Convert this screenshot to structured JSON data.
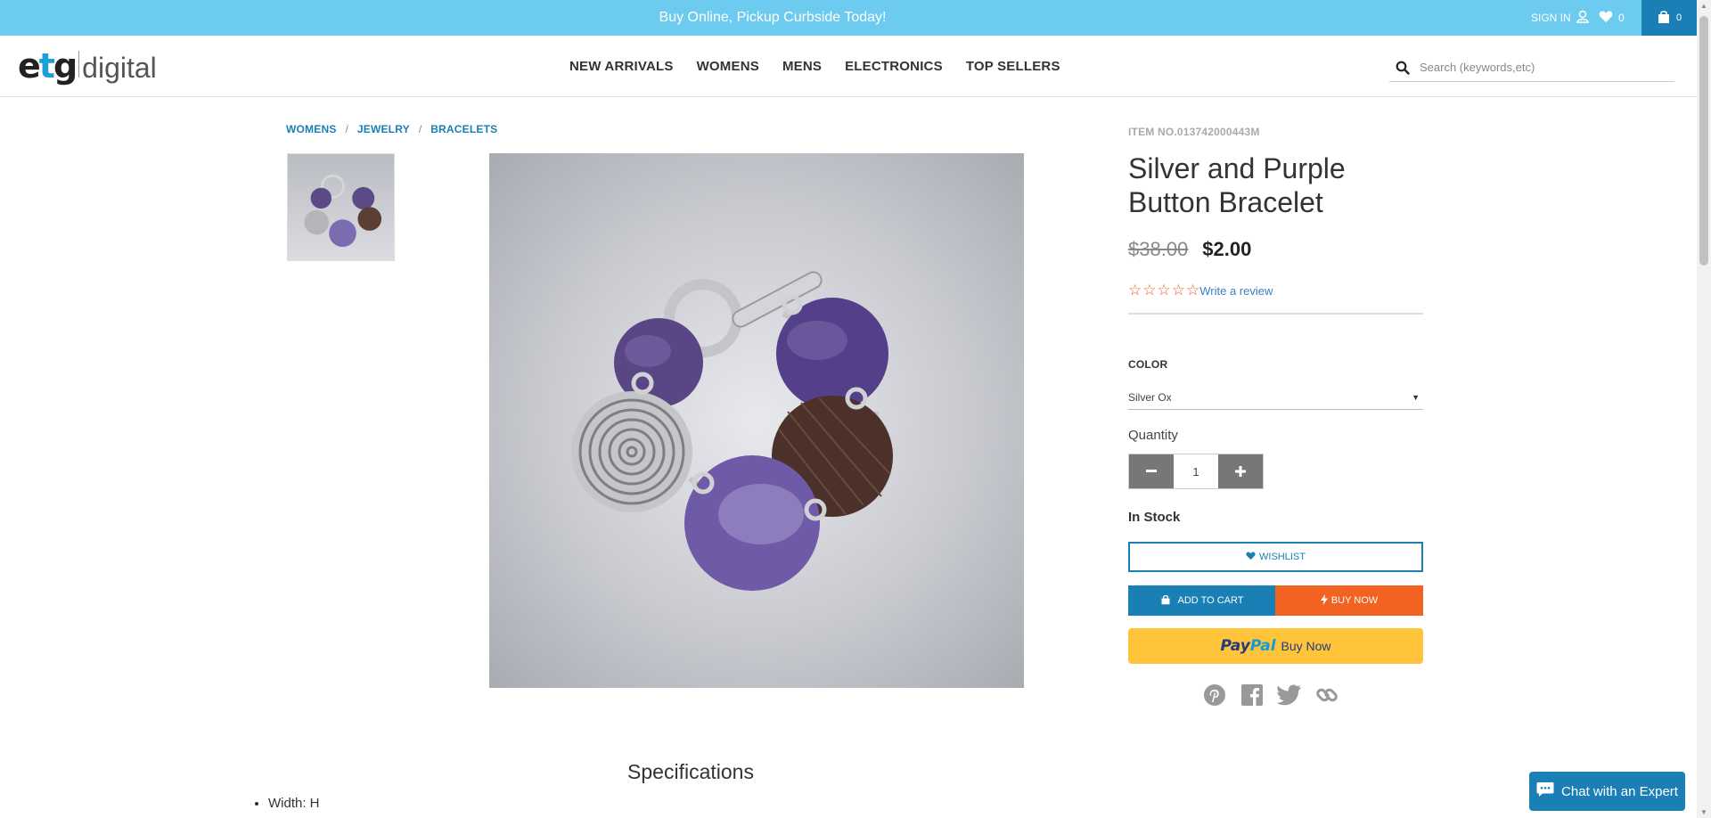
{
  "promo": {
    "text": "Buy Online, Pickup Curbside Today!"
  },
  "top_actions": {
    "sign_in": "SIGN IN",
    "wishlist_count": "0",
    "cart_count": "0"
  },
  "logo": {
    "main": "etg",
    "sub": "digital"
  },
  "nav": {
    "items": [
      "NEW ARRIVALS",
      "WOMENS",
      "MENS",
      "ELECTRONICS",
      "TOP SELLERS"
    ]
  },
  "search": {
    "placeholder": "Search (keywords,etc)"
  },
  "breadcrumb": [
    "WOMENS",
    "JEWELRY",
    "BRACELETS"
  ],
  "product": {
    "item_no": "ITEM NO.013742000443M",
    "title": "Silver and Purple Button Bracelet",
    "old_price": "$38.00",
    "new_price": "$2.00",
    "review_link": "Write a review",
    "color_label": "COLOR",
    "color_value": "Silver Ox",
    "quantity_label": "Quantity",
    "quantity_value": "1",
    "stock": "In Stock",
    "wishlist_label": "WISHLIST",
    "add_to_cart_label": "ADD TO CART",
    "buy_now_label": "BUY NOW",
    "paypal_label": "Buy Now",
    "paypal_brand_pay": "Pay",
    "paypal_brand_pal": "Pal"
  },
  "specifications": {
    "title": "Specifications",
    "items": [
      "Width: H"
    ]
  },
  "chat": {
    "label": "Chat with an Expert"
  },
  "colors": {
    "accent": "#1a7fb5",
    "promo": "#6ccbee",
    "buy_now": "#f26322",
    "paypal": "#ffc439",
    "star": "#e25a2f"
  }
}
